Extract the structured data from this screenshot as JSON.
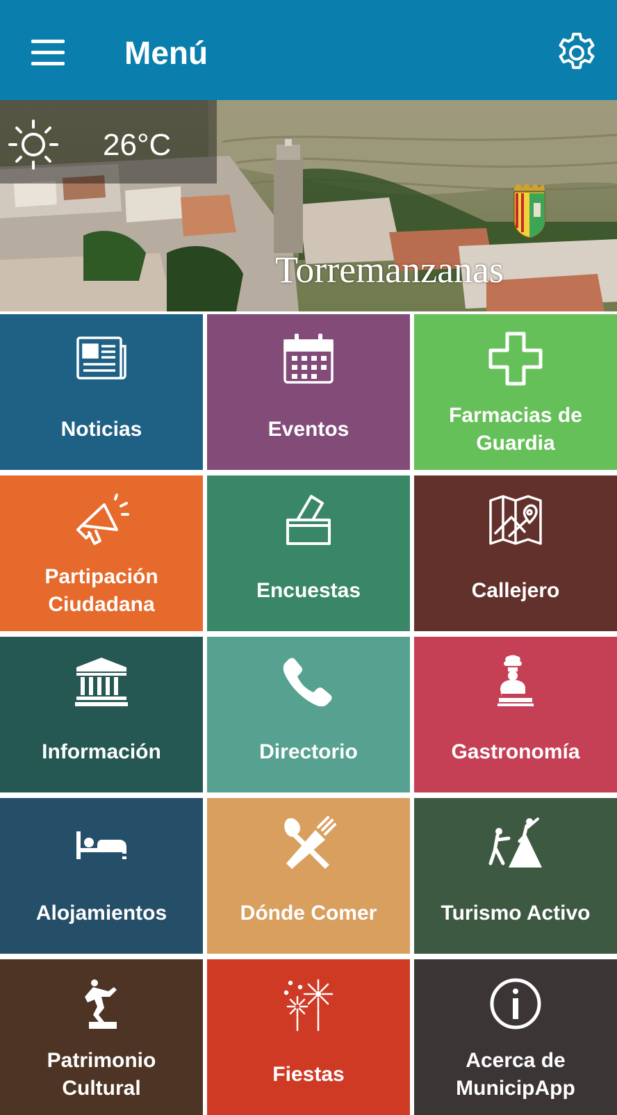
{
  "appbar": {
    "title": "Menú"
  },
  "weather": {
    "temperature": "26°C",
    "icon": "sun-icon"
  },
  "hero": {
    "town_name": "Torremanzanas"
  },
  "tiles": [
    {
      "label_1": "Noticias",
      "label_2": "",
      "color": "#1e6185",
      "icon": "newspaper-icon"
    },
    {
      "label_1": "Eventos",
      "label_2": "",
      "color": "#834c78",
      "icon": "calendar-icon"
    },
    {
      "label_1": "Farmacias de",
      "label_2": "Guardia",
      "color": "#66c059",
      "icon": "pharmacy-cross-icon"
    },
    {
      "label_1": "Partipación",
      "label_2": "Ciudadana",
      "color": "#e66a2b",
      "icon": "megaphone-icon"
    },
    {
      "label_1": "Encuestas",
      "label_2": "",
      "color": "#3a8767",
      "icon": "ballot-box-icon"
    },
    {
      "label_1": "Callejero",
      "label_2": "",
      "color": "#63312c",
      "icon": "map-icon"
    },
    {
      "label_1": "Información",
      "label_2": "",
      "color": "#255852",
      "icon": "building-columns-icon"
    },
    {
      "label_1": "Directorio",
      "label_2": "",
      "color": "#56a18f",
      "icon": "phone-icon"
    },
    {
      "label_1": "Gastronomía",
      "label_2": "",
      "color": "#c53f55",
      "icon": "chef-icon"
    },
    {
      "label_1": "Alojamientos",
      "label_2": "",
      "color": "#254f69",
      "icon": "bed-icon"
    },
    {
      "label_1": "Dónde Comer",
      "label_2": "",
      "color": "#d99f5f",
      "icon": "fork-spoon-icon"
    },
    {
      "label_1": "Turismo Activo",
      "label_2": "",
      "color": "#3e5942",
      "icon": "climbing-icon"
    },
    {
      "label_1": "Patrimonio",
      "label_2": "Cultural",
      "color": "#4e3424",
      "icon": "statue-icon"
    },
    {
      "label_1": "Fiestas",
      "label_2": "",
      "color": "#cf3a25",
      "icon": "fireworks-icon"
    },
    {
      "label_1": "Acerca de",
      "label_2": "MunicipApp",
      "color": "#3b3536",
      "icon": "info-icon"
    }
  ]
}
